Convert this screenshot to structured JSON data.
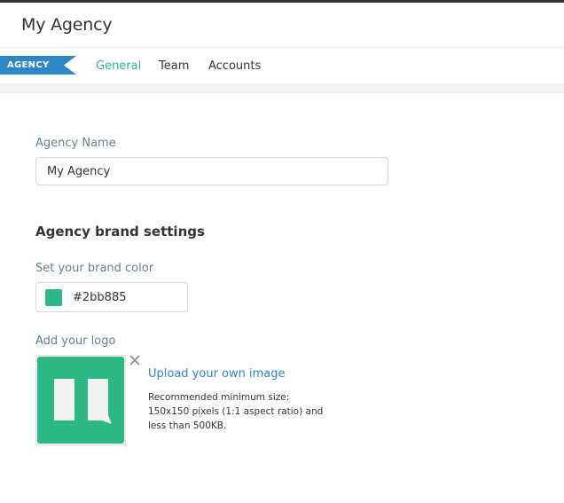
{
  "header": {
    "title": "My Agency"
  },
  "nav": {
    "section_badge": "AGENCY",
    "tabs": [
      {
        "label": "General",
        "active": true
      },
      {
        "label": "Team",
        "active": false
      },
      {
        "label": "Accounts",
        "active": false
      }
    ]
  },
  "form": {
    "agency_name_label": "Agency Name",
    "agency_name_value": "My Agency",
    "brand_heading": "Agency brand settings",
    "brand_color_label": "Set your brand color",
    "brand_color_value": "#2bb885",
    "logo_label": "Add your logo",
    "upload_link": "Upload your own image",
    "upload_hint": "Recommended minimum size: 150x150 pixels (1:1 aspect ratio) and less than 500KB."
  },
  "colors": {
    "accent": "#2bb885",
    "badge": "#2f86c7",
    "link": "#2f86c7"
  },
  "icons": {
    "logo": "speech-bubble-logo-icon",
    "remove": "close-icon"
  }
}
